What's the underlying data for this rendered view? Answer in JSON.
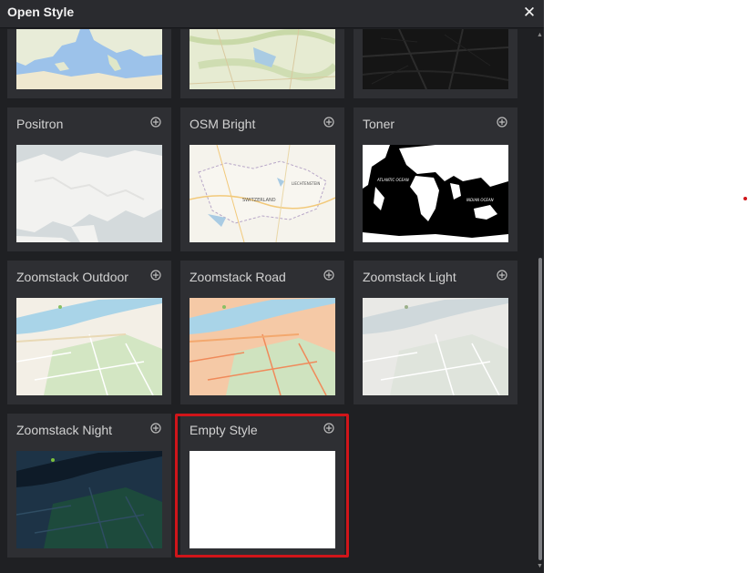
{
  "dialog": {
    "title": "Open Style",
    "close_icon": "close-icon"
  },
  "styles": [
    {
      "label": "",
      "thumb": "world-topo",
      "add_icon": "plus-circle-icon"
    },
    {
      "label": "",
      "thumb": "light-terrain",
      "add_icon": "plus-circle-icon"
    },
    {
      "label": "",
      "thumb": "dark-matter",
      "add_icon": "plus-circle-icon"
    },
    {
      "label": "Positron",
      "thumb": "positron",
      "add_icon": "plus-circle-icon"
    },
    {
      "label": "OSM Bright",
      "thumb": "osm-bright",
      "add_icon": "plus-circle-icon"
    },
    {
      "label": "Toner",
      "thumb": "toner",
      "add_icon": "plus-circle-icon"
    },
    {
      "label": "Zoomstack Outdoor",
      "thumb": "zoomstack-outdoor",
      "add_icon": "plus-circle-icon"
    },
    {
      "label": "Zoomstack Road",
      "thumb": "zoomstack-road",
      "add_icon": "plus-circle-icon"
    },
    {
      "label": "Zoomstack Light",
      "thumb": "zoomstack-light",
      "add_icon": "plus-circle-icon"
    },
    {
      "label": "Zoomstack Night",
      "thumb": "zoomstack-night",
      "add_icon": "plus-circle-icon"
    },
    {
      "label": "Empty Style",
      "thumb": "empty",
      "add_icon": "plus-circle-icon"
    }
  ],
  "map_text": {
    "toner_ocean_1": "ATLANTIC OCEAN",
    "toner_ocean_2": "INDIAN OCEAN",
    "osm_bright_country": "SWITZERLAND",
    "osm_bright_city": "LIECHTENSTEIN"
  },
  "colors": {
    "dialog_bg": "#1f2023",
    "tile_bg": "#2e2f33",
    "highlight": "#d0151a"
  }
}
